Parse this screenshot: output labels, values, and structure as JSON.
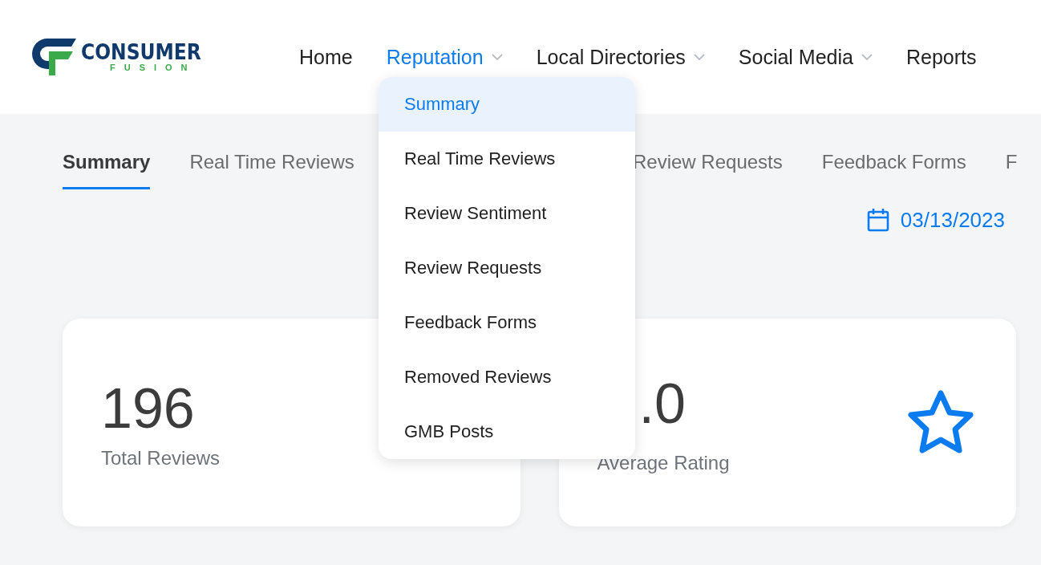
{
  "logo": {
    "name": "CONSUMER",
    "tagline": "FUSION"
  },
  "nav": [
    {
      "label": "Home",
      "selected": false,
      "dropdown": false
    },
    {
      "label": "Reputation",
      "selected": true,
      "dropdown": true
    },
    {
      "label": "Local Directories",
      "selected": false,
      "dropdown": true
    },
    {
      "label": "Social Media",
      "selected": false,
      "dropdown": true
    },
    {
      "label": "Reports",
      "selected": false,
      "dropdown": false
    }
  ],
  "menu": [
    {
      "label": "Summary",
      "selected": true
    },
    {
      "label": "Real Time Reviews",
      "selected": false
    },
    {
      "label": "Review Sentiment",
      "selected": false
    },
    {
      "label": "Review Requests",
      "selected": false
    },
    {
      "label": "Feedback Forms",
      "selected": false
    },
    {
      "label": "Removed Reviews",
      "selected": false
    },
    {
      "label": "GMB Posts",
      "selected": false
    }
  ],
  "tabs": [
    {
      "label": "Summary",
      "selected": true
    },
    {
      "label": "Real Time Reviews",
      "selected": false
    },
    {
      "label": "Review Requests",
      "selected": false
    },
    {
      "label": "Feedback Forms",
      "selected": false
    },
    {
      "label": "F",
      "selected": false
    }
  ],
  "date": "03/13/2023",
  "cards": [
    {
      "kind": "plain",
      "value": "196",
      "label": "Total Reviews"
    },
    {
      "kind": "star",
      "value": ".0",
      "label": "Average Rating"
    }
  ]
}
